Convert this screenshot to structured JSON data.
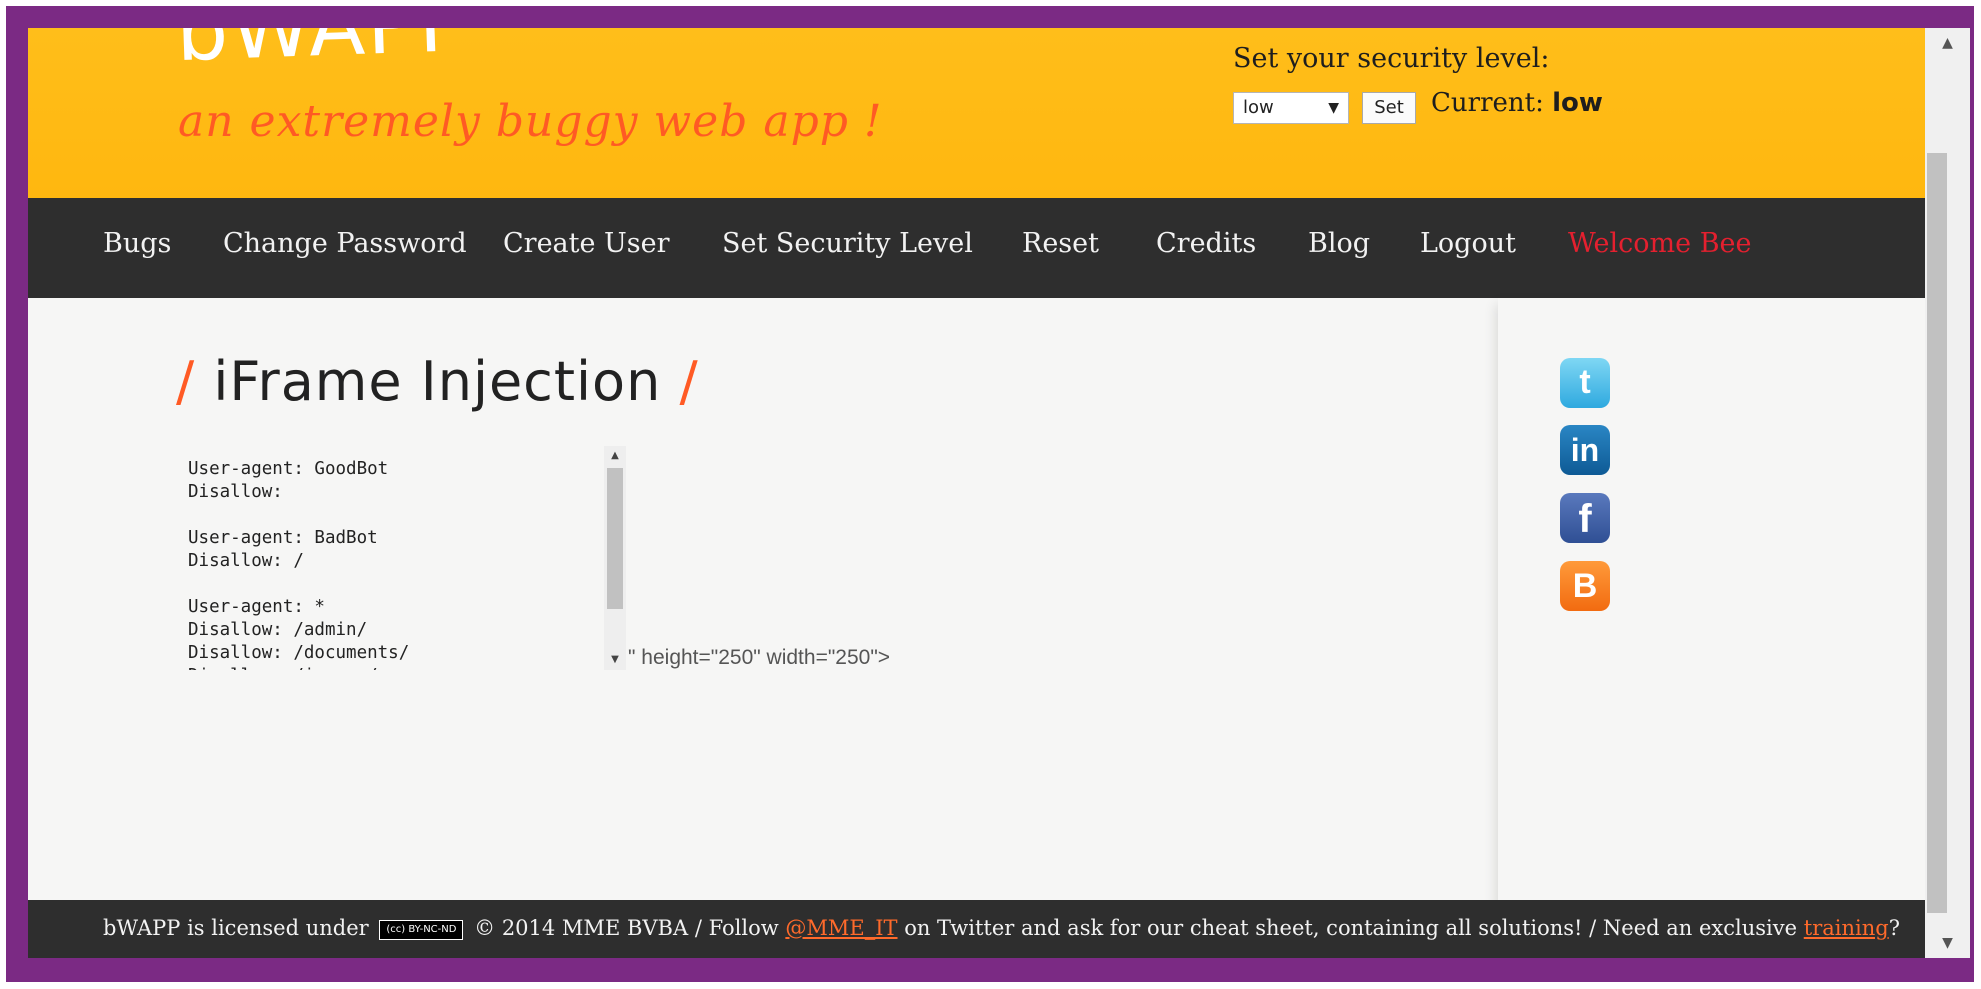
{
  "header": {
    "logo": "bWAPP",
    "subtitle": "an extremely buggy web app !",
    "security": {
      "label": "Set your security level:",
      "selected": "low",
      "set_button": "Set",
      "current_label": "Current:",
      "current_value": "low"
    }
  },
  "nav": {
    "items": [
      {
        "label": "Bugs"
      },
      {
        "label": "Change Password"
      },
      {
        "label": "Create User"
      },
      {
        "label": "Set Security Level"
      },
      {
        "label": "Reset"
      },
      {
        "label": "Credits"
      },
      {
        "label": "Blog"
      },
      {
        "label": "Logout"
      },
      {
        "label": "Welcome Bee"
      }
    ]
  },
  "main": {
    "title_slash_left": "/",
    "title": "iFrame Injection",
    "title_slash_right": "/",
    "iframe_text": "User-agent: GoodBot\nDisallow:\n\nUser-agent: BadBot\nDisallow: /\n\nUser-agent: *\nDisallow: /admin/\nDisallow: /documents/\nDisallow: /images/",
    "trailing_text": "\" height=\"250\" width=\"250\">"
  },
  "sidebar": {
    "icons": [
      "twitter-icon",
      "linkedin-icon",
      "facebook-icon",
      "blogger-icon"
    ]
  },
  "footer": {
    "part1": "bWAPP is licensed under",
    "cc_badge": "(cc) BY-NC-ND",
    "part2": "© 2014 MME BVBA / Follow",
    "twitter_link": "@MME_IT",
    "part3": "on Twitter and ask for our cheat sheet, containing all solutions! / Need an exclusive",
    "training_link": "training",
    "part4": "?"
  },
  "colors": {
    "header_bg": "#ffb70f",
    "nav_bg": "#2e2e2e",
    "accent": "#ff5a24",
    "welcome": "#e4202f",
    "frame": "#7b2a84"
  }
}
